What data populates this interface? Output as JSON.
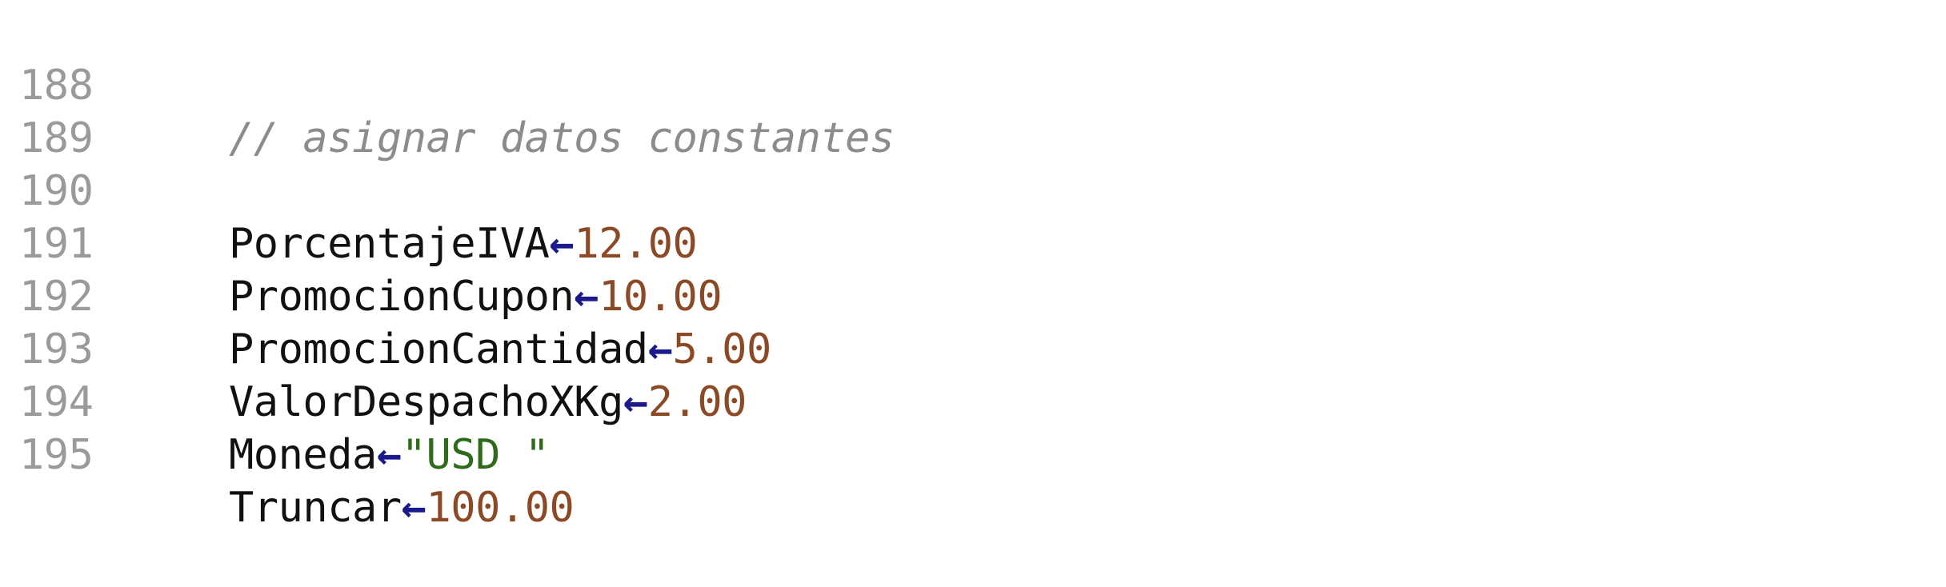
{
  "editor": {
    "lines": [
      {
        "number": "188",
        "comment": "// asignar datos constantes"
      },
      {
        "number": "189"
      },
      {
        "number": "190",
        "name": "PorcentajeIVA",
        "arrow": "←",
        "value": "12.00"
      },
      {
        "number": "191",
        "name": "PromocionCupon",
        "arrow": "←",
        "value": "10.00"
      },
      {
        "number": "192",
        "name": "PromocionCantidad",
        "arrow": "←",
        "value": "5.00"
      },
      {
        "number": "193",
        "name": "ValorDespachoXKg",
        "arrow": "←",
        "value": "2.00"
      },
      {
        "number": "194",
        "name": "Moneda",
        "arrow": "←",
        "value": "\"USD \""
      },
      {
        "number": "195",
        "name": "Truncar",
        "arrow": "←",
        "value": "100.00"
      }
    ]
  },
  "colors": {
    "line_number": "#9a9a9a",
    "comment": "#8c8c8c",
    "identifier": "#111111",
    "assignment_arrow": "#1a1a8c",
    "number_literal": "#8b4a25",
    "string_literal": "#2e6b1a"
  }
}
